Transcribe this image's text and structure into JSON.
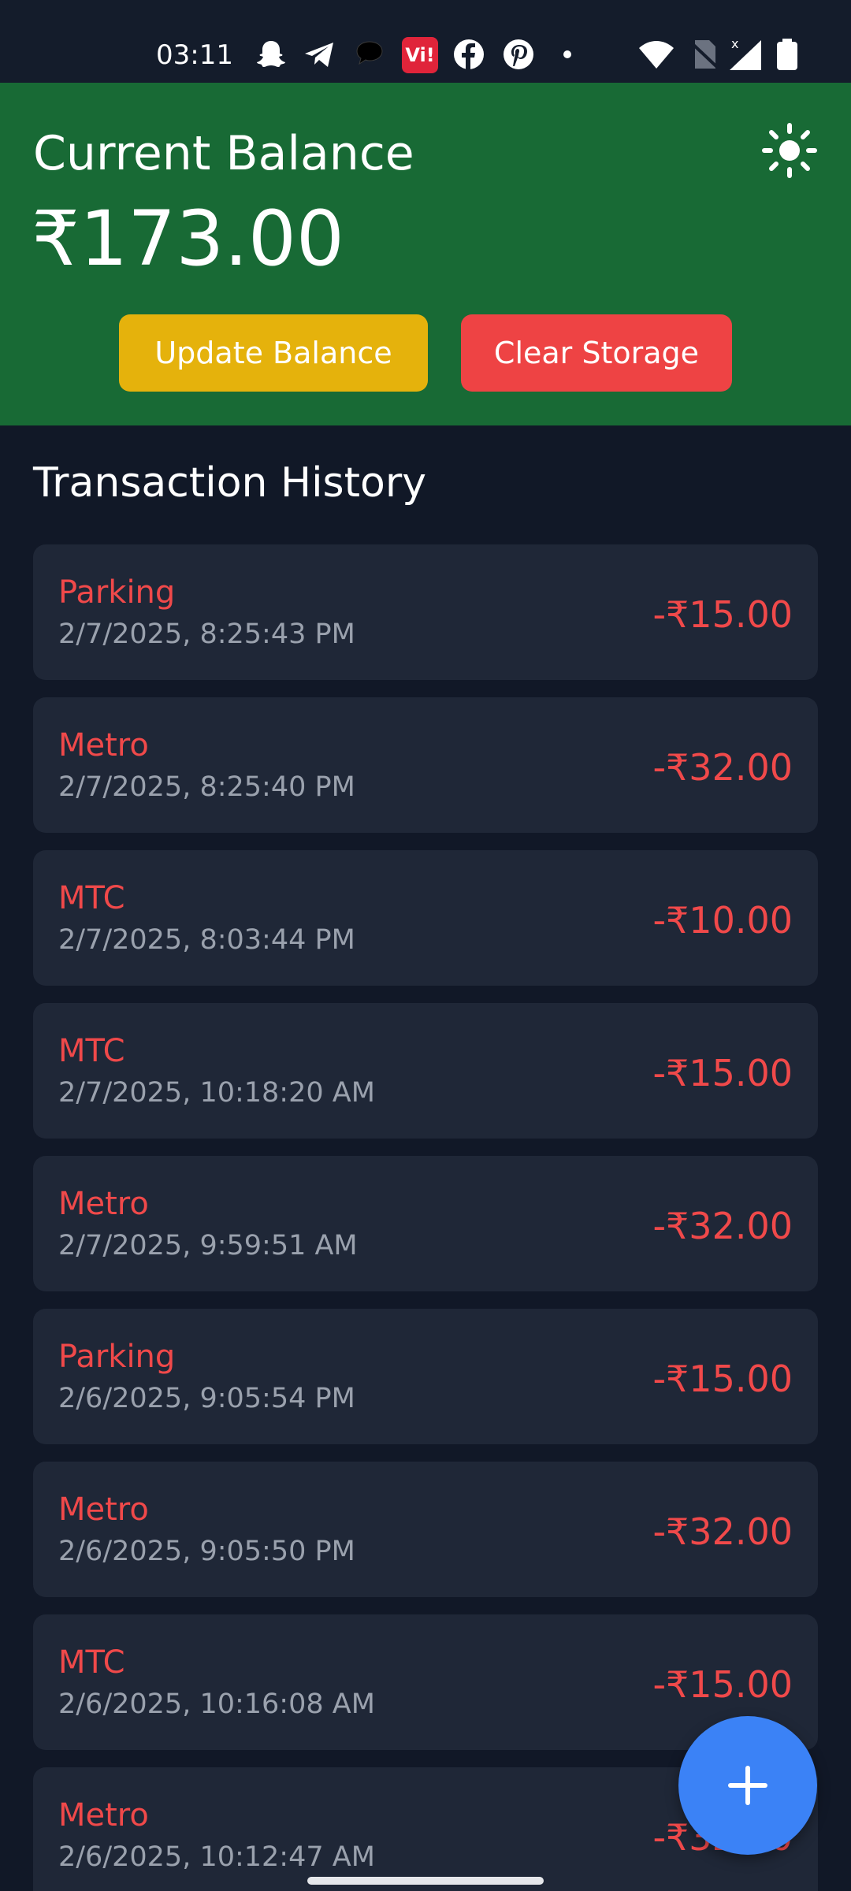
{
  "status_bar": {
    "time": "03:11",
    "notification_icons": [
      "snapchat-icon",
      "telegram-icon",
      "threads-icon",
      "vi-icon",
      "facebook-icon",
      "pinterest-icon",
      "dot-icon"
    ],
    "system_icons": [
      "wifi-icon",
      "no-sim-icon",
      "signal-icon",
      "battery-icon"
    ],
    "vi_label": "Vi!"
  },
  "header": {
    "title": "Current Balance",
    "balance": "₹173.00",
    "theme_icon": "sun-icon",
    "update_button": "Update Balance",
    "clear_button": "Clear Storage",
    "colors": {
      "background": "#186a35",
      "update": "#e5b20c",
      "clear": "#ee4344"
    }
  },
  "history": {
    "title": "Transaction History",
    "transactions": [
      {
        "name": "Parking",
        "date": "2/7/2025, 8:25:43 PM",
        "amount": "-₹15.00"
      },
      {
        "name": "Metro",
        "date": "2/7/2025, 8:25:40 PM",
        "amount": "-₹32.00"
      },
      {
        "name": "MTC",
        "date": "2/7/2025, 8:03:44 PM",
        "amount": "-₹10.00"
      },
      {
        "name": "MTC",
        "date": "2/7/2025, 10:18:20 AM",
        "amount": "-₹15.00"
      },
      {
        "name": "Metro",
        "date": "2/7/2025, 9:59:51 AM",
        "amount": "-₹32.00"
      },
      {
        "name": "Parking",
        "date": "2/6/2025, 9:05:54 PM",
        "amount": "-₹15.00"
      },
      {
        "name": "Metro",
        "date": "2/6/2025, 9:05:50 PM",
        "amount": "-₹32.00"
      },
      {
        "name": "MTC",
        "date": "2/6/2025, 10:16:08 AM",
        "amount": "-₹15.00"
      },
      {
        "name": "Metro",
        "date": "2/6/2025, 10:12:47 AM",
        "amount": "-₹32.00"
      }
    ]
  },
  "fab": {
    "icon": "plus-icon",
    "color": "#3b82f6"
  },
  "theme_colors": {
    "page_bg": "#111827",
    "card_bg": "#1f2737",
    "expense": "#f0494a",
    "muted": "#9aa1ad"
  }
}
